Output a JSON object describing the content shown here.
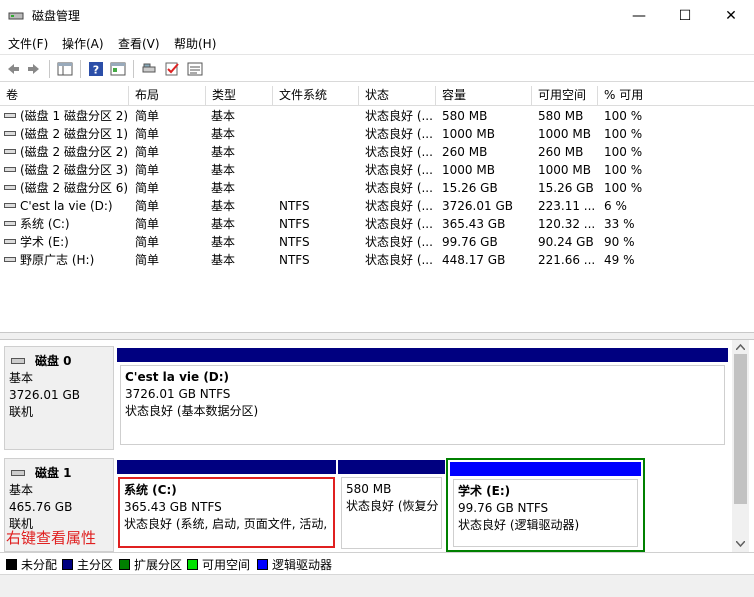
{
  "window": {
    "title": "磁盘管理",
    "minimize": "—",
    "maximize": "☐",
    "close": "✕"
  },
  "menu": [
    "文件(F)",
    "操作(A)",
    "查看(V)",
    "帮助(H)"
  ],
  "toolbar": {
    "icons": [
      "back-icon",
      "forward-icon",
      "console-tree-icon",
      "help-icon",
      "properties-icon",
      "connect-icon",
      "check-icon",
      "list-view-icon"
    ]
  },
  "columns": [
    "卷",
    "布局",
    "类型",
    "文件系统",
    "状态",
    "容量",
    "可用空间",
    "% 可用"
  ],
  "volumes": [
    {
      "vol": "(磁盘 1 磁盘分区 2)",
      "layout": "简单",
      "type": "基本",
      "fs": "",
      "status": "状态良好 (...",
      "cap": "580 MB",
      "free": "580 MB",
      "pct": "100 %"
    },
    {
      "vol": "(磁盘 2 磁盘分区 1)",
      "layout": "简单",
      "type": "基本",
      "fs": "",
      "status": "状态良好 (...",
      "cap": "1000 MB",
      "free": "1000 MB",
      "pct": "100 %"
    },
    {
      "vol": "(磁盘 2 磁盘分区 2)",
      "layout": "简单",
      "type": "基本",
      "fs": "",
      "status": "状态良好 (...",
      "cap": "260 MB",
      "free": "260 MB",
      "pct": "100 %"
    },
    {
      "vol": "(磁盘 2 磁盘分区 3)",
      "layout": "简单",
      "type": "基本",
      "fs": "",
      "status": "状态良好 (...",
      "cap": "1000 MB",
      "free": "1000 MB",
      "pct": "100 %"
    },
    {
      "vol": "(磁盘 2 磁盘分区 6)",
      "layout": "简单",
      "type": "基本",
      "fs": "",
      "status": "状态良好 (...",
      "cap": "15.26 GB",
      "free": "15.26 GB",
      "pct": "100 %"
    },
    {
      "vol": "C'est la vie (D:)",
      "layout": "简单",
      "type": "基本",
      "fs": "NTFS",
      "status": "状态良好 (...",
      "cap": "3726.01 GB",
      "free": "223.11 ...",
      "pct": "6 %"
    },
    {
      "vol": "系统 (C:)",
      "layout": "简单",
      "type": "基本",
      "fs": "NTFS",
      "status": "状态良好 (...",
      "cap": "365.43 GB",
      "free": "120.32 ...",
      "pct": "33 %"
    },
    {
      "vol": "学术 (E:)",
      "layout": "简单",
      "type": "基本",
      "fs": "NTFS",
      "status": "状态良好 (...",
      "cap": "99.76 GB",
      "free": "90.24 GB",
      "pct": "90 %"
    },
    {
      "vol": "野原广志 (H:)",
      "layout": "简单",
      "type": "基本",
      "fs": "NTFS",
      "status": "状态良好 (...",
      "cap": "448.17 GB",
      "free": "221.66 ...",
      "pct": "49 %"
    }
  ],
  "disks": [
    {
      "name": "磁盘 0",
      "type": "基本",
      "size": "3726.01 GB",
      "state": "联机",
      "partitions": [
        {
          "title": "C'est la vie  (D:)",
          "line1": "3726.01 GB NTFS",
          "line2": "状态良好 (基本数据分区)"
        }
      ]
    },
    {
      "name": "磁盘 1",
      "type": "基本",
      "size": "465.76 GB",
      "state": "联机",
      "partitions": [
        {
          "title": "系统  (C:)",
          "line1": "365.43 GB NTFS",
          "line2": "状态良好 (系统, 启动, 页面文件, 活动,"
        },
        {
          "title": "",
          "line1": "580 MB",
          "line2": "状态良好 (恢复分"
        },
        {
          "title": "学术  (E:)",
          "line1": "99.76 GB NTFS",
          "line2": "状态良好 (逻辑驱动器)"
        }
      ]
    }
  ],
  "annotation": "右键查看属性",
  "legend": [
    {
      "label": "未分配",
      "color": "#000000"
    },
    {
      "label": "主分区",
      "color": "#000080"
    },
    {
      "label": "扩展分区",
      "color": "#008000"
    },
    {
      "label": "可用空间",
      "color": "#00e000"
    },
    {
      "label": "逻辑驱动器",
      "color": "#0000ff"
    }
  ],
  "colors": {
    "primary": "#000080",
    "extended": "#008000",
    "logical": "#0000ff",
    "highlight": "#e02020"
  }
}
